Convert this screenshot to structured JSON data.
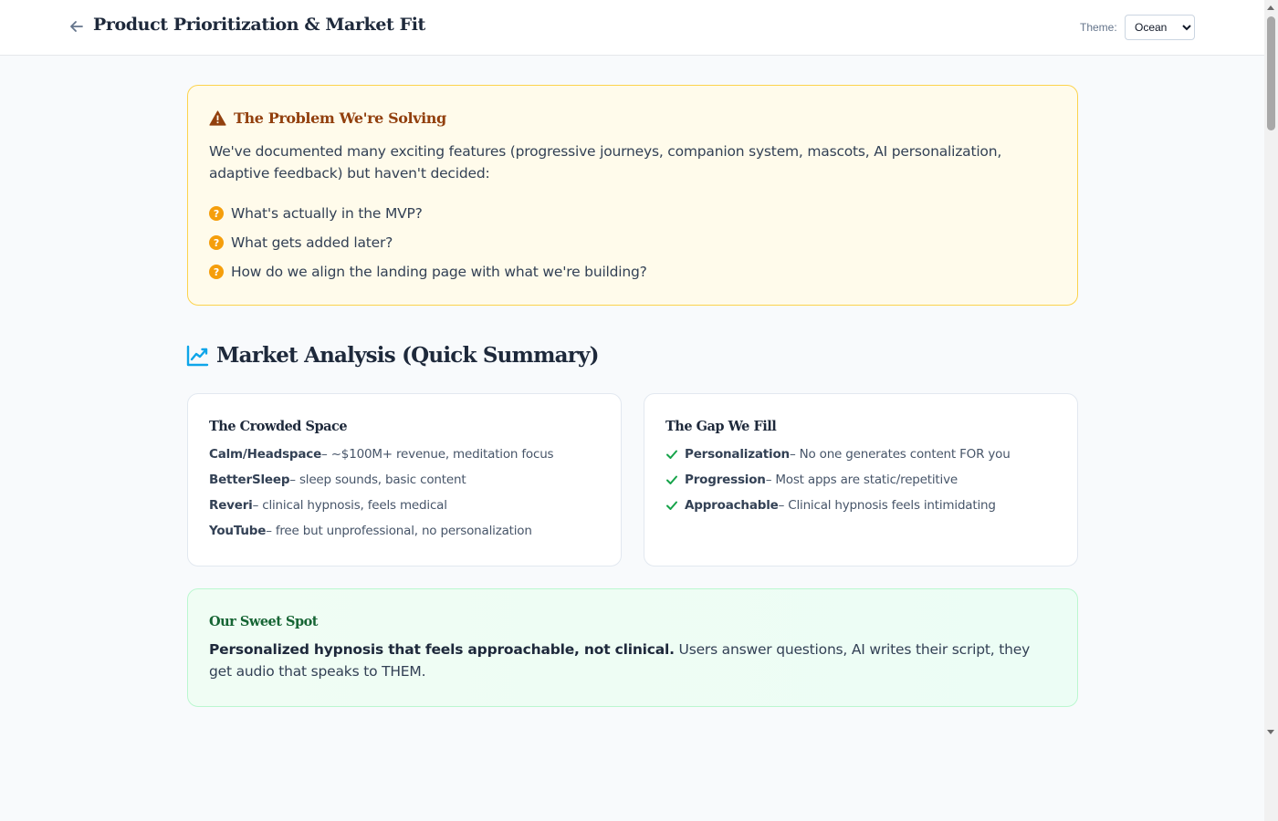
{
  "header": {
    "title": "Product Prioritization & Market Fit",
    "theme_label": "Theme:",
    "theme_value": "Ocean"
  },
  "problem": {
    "title": "The Problem We're Solving",
    "intro": "We've documented many exciting features (progressive journeys, companion system, mascots, AI personalization, adaptive feedback) but haven't decided:",
    "question_icon": "?",
    "questions": [
      "What's actually in the MVP?",
      "What gets added later?",
      "How do we align the landing page with what we're building?"
    ]
  },
  "market": {
    "heading": "Market Analysis (Quick Summary)",
    "crowded": {
      "title": "The Crowded Space",
      "items": [
        {
          "name": "Calm/Headspace",
          "desc": " – ~$100M+ revenue, meditation focus"
        },
        {
          "name": "BetterSleep",
          "desc": " – sleep sounds, basic content"
        },
        {
          "name": "Reveri",
          "desc": " – clinical hypnosis, feels medical"
        },
        {
          "name": "YouTube",
          "desc": " – free but unprofessional, no personalization"
        }
      ]
    },
    "gap": {
      "title": "The Gap We Fill",
      "items": [
        {
          "name": "Personalization",
          "desc": " – No one generates content FOR you"
        },
        {
          "name": "Progression",
          "desc": " – Most apps are static/repetitive"
        },
        {
          "name": "Approachable",
          "desc": " – Clinical hypnosis feels intimidating"
        }
      ]
    },
    "sweet_spot": {
      "title": "Our Sweet Spot",
      "bold": "Personalized hypnosis that feels approachable, not clinical.",
      "text": " Users answer questions, AI writes their script, they get audio that speaks to THEM."
    }
  },
  "icons": {
    "back": "arrow-left-icon",
    "warning": "warning-triangle-icon",
    "question": "question-circle-icon",
    "chart": "line-chart-icon",
    "check": "check-icon"
  },
  "colors": {
    "warning": "#92400e",
    "question": "#f59e0b",
    "chart": "#0ea5e9",
    "check": "#16a34a",
    "sweet_title": "#166534"
  }
}
